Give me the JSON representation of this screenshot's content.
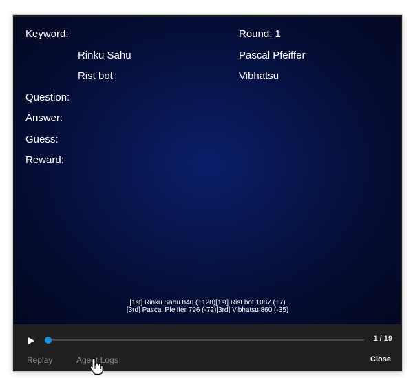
{
  "board": {
    "keyword_label": "Keyword:",
    "round_label": "Round: 1",
    "players": {
      "team1_a": "Rinku Sahu",
      "team1_b": "Rist bot",
      "team2_a": "Pascal Pfeiffer",
      "team2_b": "Vibhatsu"
    },
    "question_label": "Question:",
    "answer_label": "Answer:",
    "guess_label": "Guess:",
    "reward_label": "Reward:"
  },
  "standings": {
    "line1": "[1st] Rinku Sahu 840 (+128)[1st] Rist bot 1087 (+7)",
    "line2": "[3rd] Pascal Pfeiffer 796 (-72)[3rd] Vibhatsu 860 (-35)"
  },
  "player": {
    "step_counter": "1 / 19",
    "progress": 0,
    "replay_label": "Replay",
    "logs_label": "Agent Logs",
    "close_label": "Close"
  },
  "icons": {
    "play": "play-icon",
    "cursor": "hand-pointer-icon"
  },
  "colors": {
    "accent": "#1a8fd8",
    "stage_dark": "#030820",
    "stage_center": "#0b1f6a"
  }
}
